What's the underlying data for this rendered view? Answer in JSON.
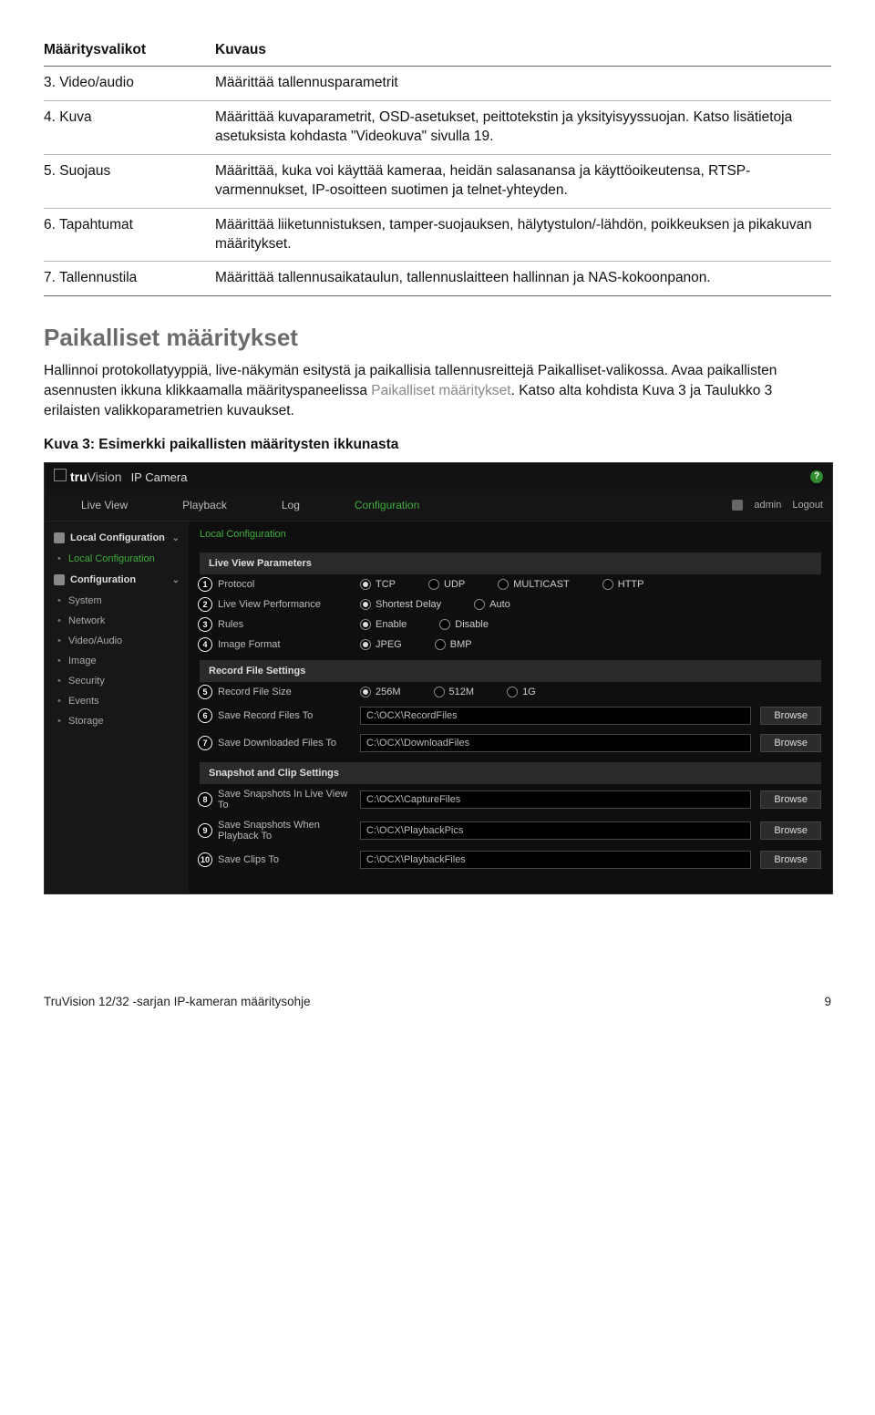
{
  "table": {
    "head": {
      "col1": "Määritysvalikot",
      "col2": "Kuvaus"
    },
    "rows": [
      {
        "c1": "3.  Video/audio",
        "c2": "Määrittää tallennusparametrit"
      },
      {
        "c1": "4.  Kuva",
        "c2": "Määrittää kuvaparametrit, OSD-asetukset, peittotekstin ja yksityisyyssuojan. Katso lisätietoja asetuksista kohdasta \"Videokuva\" sivulla 19."
      },
      {
        "c1": "5.  Suojaus",
        "c2": "Määrittää, kuka voi käyttää kameraa, heidän salasanansa ja käyttöoikeutensa, RTSP-varmennukset, IP-osoitteen suotimen ja telnet-yhteyden."
      },
      {
        "c1": "6.  Tapahtumat",
        "c2": "Määrittää liiketunnistuksen, tamper-suojauksen, hälytystulon/-lähdön, poikkeuksen ja pikakuvan määritykset."
      },
      {
        "c1": "7.  Tallennustila",
        "c2": "Määrittää tallennusaikataulun, tallennuslaitteen hallinnan ja NAS-kokoonpanon."
      }
    ]
  },
  "section_title": "Paikalliset määritykset",
  "para_pre": "Hallinnoi protokollatyyppiä, live-näkymän esitystä ja paikallisia tallennusreittejä Paikalliset-valikossa. Avaa paikallisten asennusten ikkuna klikkaamalla määrityspaneelissa ",
  "para_gray": "Paikalliset määritykset",
  "para_post": ". Katso alta kohdista Kuva 3 ja Taulukko 3 erilaisten valikkoparametrien kuvaukset.",
  "fig_caption": "Kuva 3: Esimerkki paikallisten määritysten ikkunasta",
  "shot": {
    "brand": {
      "tru": "tru",
      "vision": "Vision",
      "sub": "IP Camera"
    },
    "help": "?",
    "tabs": [
      "Live View",
      "Playback",
      "Log",
      "Configuration"
    ],
    "tabs_active": 3,
    "user": {
      "name": "admin",
      "logout": "Logout"
    },
    "side": {
      "grp1": "Local Configuration",
      "grp1_item": "Local Configuration",
      "grp2": "Configuration",
      "items": [
        "System",
        "Network",
        "Video/Audio",
        "Image",
        "Security",
        "Events",
        "Storage"
      ]
    },
    "crumb": "Local Configuration",
    "panel1": "Live View Parameters",
    "rows1": [
      {
        "n": "1",
        "lbl": "Protocol",
        "opts": [
          "TCP",
          "UDP",
          "MULTICAST",
          "HTTP"
        ],
        "sel": 0
      },
      {
        "n": "2",
        "lbl": "Live View Performance",
        "opts": [
          "Shortest Delay",
          "Auto"
        ],
        "sel": 0
      },
      {
        "n": "3",
        "lbl": "Rules",
        "opts": [
          "Enable",
          "Disable"
        ],
        "sel": 0
      },
      {
        "n": "4",
        "lbl": "Image Format",
        "opts": [
          "JPEG",
          "BMP"
        ],
        "sel": 0
      }
    ],
    "panel2": "Record File Settings",
    "rows2": [
      {
        "n": "5",
        "lbl": "Record File Size",
        "type": "radio",
        "opts": [
          "256M",
          "512M",
          "1G"
        ],
        "sel": 0
      },
      {
        "n": "6",
        "lbl": "Save Record Files To",
        "type": "field",
        "val": "C:\\OCX\\RecordFiles",
        "btn": "Browse"
      },
      {
        "n": "7",
        "lbl": "Save Downloaded Files To",
        "type": "field",
        "val": "C:\\OCX\\DownloadFiles",
        "btn": "Browse"
      }
    ],
    "panel3": "Snapshot and Clip Settings",
    "rows3": [
      {
        "n": "8",
        "lbl": "Save Snapshots In Live View To",
        "val": "C:\\OCX\\CaptureFiles",
        "btn": "Browse"
      },
      {
        "n": "9",
        "lbl": "Save Snapshots When Playback To",
        "val": "C:\\OCX\\PlaybackPics",
        "btn": "Browse"
      },
      {
        "n": "10",
        "lbl": "Save Clips To",
        "val": "C:\\OCX\\PlaybackFiles",
        "btn": "Browse"
      }
    ]
  },
  "footer": {
    "left": "TruVision 12/32 -sarjan IP-kameran määritysohje",
    "right": "9"
  }
}
